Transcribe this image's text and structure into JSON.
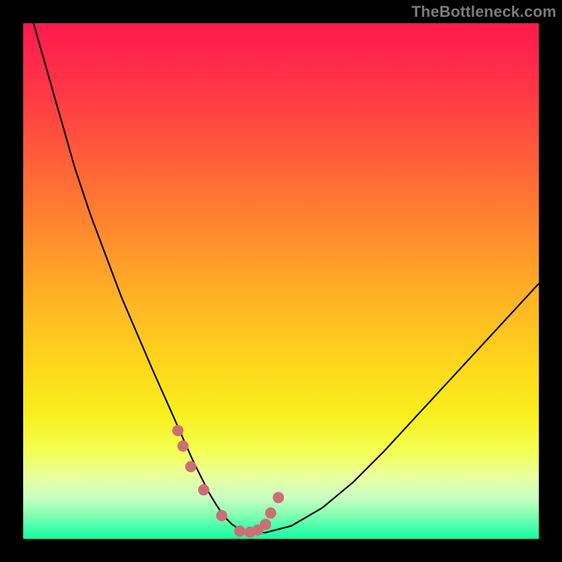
{
  "watermark": "TheBottleneck.com",
  "chart_data": {
    "type": "line",
    "title": "",
    "xlabel": "",
    "ylabel": "",
    "xlim": [
      0,
      100
    ],
    "ylim": [
      0,
      100
    ],
    "grid": false,
    "series": [
      {
        "name": "bottleneck-curve",
        "x": [
          2,
          4,
          6,
          8,
          10,
          13,
          16,
          19,
          22,
          25,
          27,
          29,
          31,
          33,
          34.5,
          36,
          37.5,
          39,
          40.5,
          42,
          43.5,
          47,
          52,
          58,
          64,
          70,
          76,
          82,
          88,
          94,
          100
        ],
        "values": [
          100,
          93,
          86,
          79,
          72,
          63,
          55,
          47,
          40,
          33,
          28.5,
          24,
          19.5,
          15,
          12,
          9,
          6.5,
          4.3,
          2.8,
          1.8,
          1.3,
          1.2,
          2.5,
          6,
          11,
          17,
          23.5,
          30,
          36.5,
          43,
          49.5
        ]
      }
    ],
    "markers": {
      "name": "highlight-points",
      "x": [
        30,
        31,
        32.5,
        35,
        38.5,
        42,
        44,
        45.5,
        47,
        48,
        49.5
      ],
      "values": [
        21,
        18,
        14,
        9.5,
        4.5,
        1.5,
        1.3,
        1.7,
        2.8,
        5,
        8
      ]
    },
    "colors": {
      "curve": "#000000",
      "markers": "#cc6f74",
      "gradient_top": "#ff1a4d",
      "gradient_bottom": "#17ffa4"
    }
  }
}
